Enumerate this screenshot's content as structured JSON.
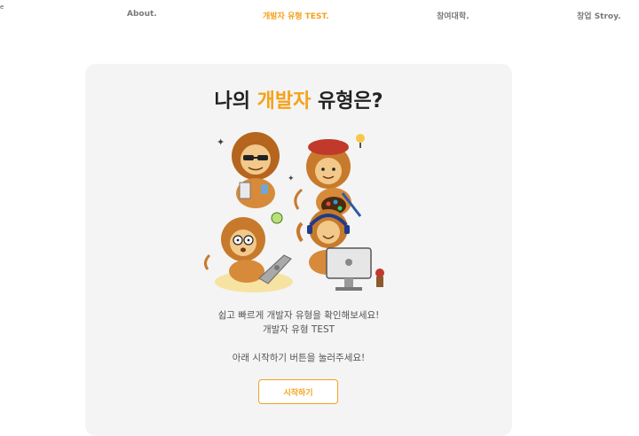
{
  "corner_mark": "e",
  "nav": {
    "about": "About.",
    "test": "개발자 유형 TEST.",
    "univ": "참여대학.",
    "story": "창업 Stroy."
  },
  "card": {
    "title_prefix": "나의 ",
    "title_accent": "개발자",
    "title_suffix": " 유형은?",
    "desc1": "쉽고 빠르게 개발자 유형을 확인해보세요!",
    "desc2": "개발자 유형 TEST",
    "desc3": "아래 시작하기 버튼을 눌러주세요!",
    "start_button": "시작하기"
  },
  "colors": {
    "accent": "#f5a21b",
    "card_bg": "#f4f4f4",
    "nav_text": "#7a7a7a"
  },
  "illustration": {
    "icons": [
      "lion-sunglasses-icon",
      "lion-artist-icon",
      "lion-laptop-icon",
      "lion-desktop-icon"
    ]
  }
}
